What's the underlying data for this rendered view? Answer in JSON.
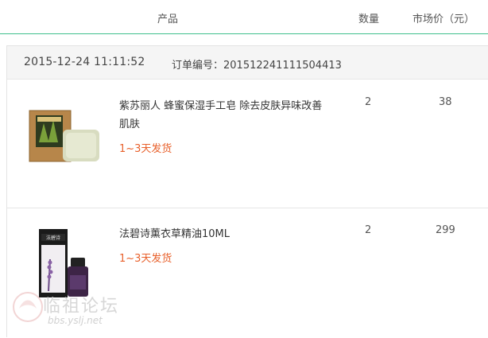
{
  "header": {
    "product_label": "产品",
    "qty_label": "数量",
    "price_label": "市场价（元）"
  },
  "order": {
    "date": "2015-12-24 11:11:52",
    "number_text": "订单编号：201512241111504413"
  },
  "items": [
    {
      "title": "紫苏丽人 蜂蜜保湿手工皂 除去皮肤异味改善肌肤",
      "shipping": "1~3天发货",
      "qty": "2",
      "price": "38"
    },
    {
      "title": "法碧诗薰衣草精油10ML",
      "shipping": "1~3天发货",
      "qty": "2",
      "price": "299"
    }
  ],
  "watermark": {
    "text": "临祖论坛",
    "url": "bbs.yslj.net",
    "brand_box": "法碧诗"
  },
  "colors": {
    "accent_line": "#3fbf8c",
    "shipping_text": "#e8612c"
  }
}
